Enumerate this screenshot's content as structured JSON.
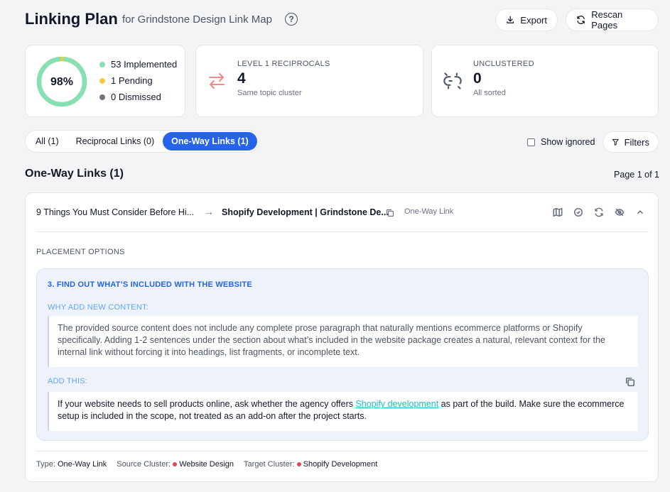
{
  "header": {
    "title": "Linking Plan",
    "subtitle": "for Grindstone Design Link Map",
    "help": "?",
    "export_label": "Export",
    "rescan_label": "Rescan Pages"
  },
  "progress": {
    "percent_label": "98%",
    "fraction": 0.98,
    "implemented": "53 Implemented",
    "pending": "1 Pending",
    "dismissed": "0 Dismissed",
    "colors": {
      "implemented": "#86e0b4",
      "pending": "#f5c842",
      "dismissed": "#6b7280"
    }
  },
  "reciprocals": {
    "label": "LEVEL 1 RECIPROCALS",
    "value": "4",
    "sub": "Same topic cluster",
    "icon": "swap-arrows-icon",
    "color": "#f08b8b"
  },
  "unclustered": {
    "label": "UNCLUSTERED",
    "value": "0",
    "sub": "All sorted",
    "icon": "broken-link-icon"
  },
  "tabs": [
    {
      "label": "All (1)"
    },
    {
      "label": "Reciprocal Links (0)"
    },
    {
      "label": "One-Way Links (1)"
    }
  ],
  "show_ignored_label": "Show ignored",
  "filters_label": "Filters",
  "section_title": "One-Way Links (1)",
  "page_info": "Page 1 of 1",
  "link": {
    "source": "9 Things You Must Consider Before Hi...",
    "arrow": "→",
    "target": "Shopify Development | Grindstone De...",
    "type_badge": "One-Way Link",
    "placement_label": "PLACEMENT OPTIONS",
    "option_title": "3. FIND OUT WHAT’S INCLUDED WITH THE WEBSITE",
    "why_label": "WHY ADD NEW CONTENT:",
    "why_text": "The provided source content does not include any complete prose paragraph that naturally mentions ecommerce platforms or Shopify specifically. Adding 1-2 sentences under the section about what’s included in the website package creates a natural, relevant context for the internal link without forcing it into headings, list fragments, or incomplete text.",
    "add_label": "ADD THIS:",
    "add_before": "If your website needs to sell products online, ask whether the agency offers ",
    "add_link": "Shopify development",
    "add_after": " as part of the build. Make sure the ecommerce setup is included in the scope, not treated as an add-on after the project starts.",
    "meta": {
      "type_label": "Type:",
      "type_value": "One-Way Link",
      "source_label": "Source Cluster:",
      "source_value": "Website Design",
      "target_label": "Target Cluster:",
      "target_value": "Shopify Development",
      "dot_color": "#e0474c"
    }
  }
}
